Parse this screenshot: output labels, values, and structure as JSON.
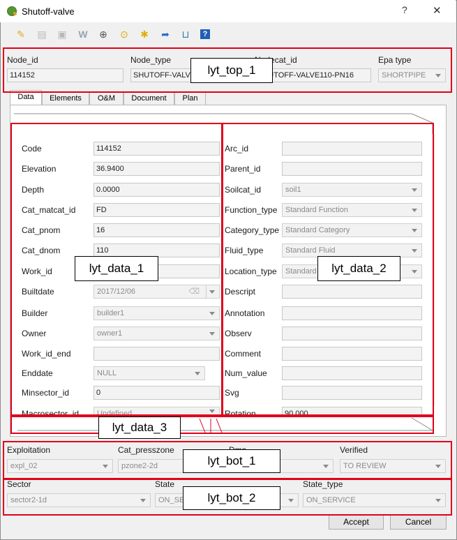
{
  "window": {
    "title": "Shutoff-valve",
    "help_glyph": "?",
    "close_glyph": "✕"
  },
  "toolbar": {
    "tools": [
      "edit-pencil-icon",
      "copy-icon",
      "paste-icon",
      "word-icon",
      "zoom-icon",
      "search-icon",
      "cluster-icon",
      "redo-icon",
      "bucket-icon",
      "help-icon"
    ]
  },
  "top": {
    "node_id_label": "Node_id",
    "node_id_value": "114152",
    "node_type_label": "Node_type",
    "node_type_value": "SHUTOFF-VALVE",
    "nodecat_id_label": "Nodecat_id",
    "nodecat_id_value": "SHUTOFF-VALVE110-PN16",
    "epa_type_label": "Epa type",
    "epa_type_value": "SHORTPIPE"
  },
  "tabs": [
    "Data",
    "Elements",
    "O&M",
    "Document",
    "Plan"
  ],
  "data_left": [
    {
      "label": "Code",
      "value": "114152",
      "kind": "field"
    },
    {
      "label": "Elevation",
      "value": "36.9400",
      "kind": "field"
    },
    {
      "label": "Depth",
      "value": "0.0000",
      "kind": "field"
    },
    {
      "label": "Cat_matcat_id",
      "value": "FD",
      "kind": "field"
    },
    {
      "label": "Cat_pnom",
      "value": "16",
      "kind": "field"
    },
    {
      "label": "Cat_dnom",
      "value": "110",
      "kind": "field"
    },
    {
      "label": "Work_id",
      "value": "",
      "kind": "field"
    },
    {
      "label": "Builtdate",
      "value": "2017/12/06",
      "kind": "date"
    },
    {
      "label": "Builder",
      "value": "builder1",
      "kind": "combo"
    },
    {
      "label": "Owner",
      "value": "owner1",
      "kind": "combo"
    },
    {
      "label": "Work_id_end",
      "value": "",
      "kind": "field"
    },
    {
      "label": "Enddate",
      "value": "NULL",
      "kind": "combo"
    },
    {
      "label": "Minsector_id",
      "value": "0",
      "kind": "field"
    },
    {
      "label": "Macrosector_id",
      "value": "Undefined",
      "kind": "combo"
    }
  ],
  "data_right": [
    {
      "label": "Arc_id",
      "value": "",
      "kind": "field"
    },
    {
      "label": "Parent_id",
      "value": "",
      "kind": "field"
    },
    {
      "label": "Soilcat_id",
      "value": "soil1",
      "kind": "combo"
    },
    {
      "label": "Function_type",
      "value": "Standard Function",
      "kind": "combo"
    },
    {
      "label": "Category_type",
      "value": "Standard Category",
      "kind": "combo"
    },
    {
      "label": "Fluid_type",
      "value": "Standard Fluid",
      "kind": "combo"
    },
    {
      "label": "Location_type",
      "value": "Standard Location",
      "kind": "combo"
    },
    {
      "label": "Descript",
      "value": "",
      "kind": "field"
    },
    {
      "label": "Annotation",
      "value": "",
      "kind": "field"
    },
    {
      "label": "Observ",
      "value": "",
      "kind": "field"
    },
    {
      "label": "Comment",
      "value": "",
      "kind": "field"
    },
    {
      "label": "Num_value",
      "value": "",
      "kind": "field"
    },
    {
      "label": "Svg",
      "value": "",
      "kind": "field"
    },
    {
      "label": "Rotation",
      "value": "90.000",
      "kind": "field"
    }
  ],
  "bot1": {
    "exploitation_label": "Exploitation",
    "exploitation_value": "expl_02",
    "presszone_label": "Cat_presszone",
    "presszone_value": "pzone2-2d",
    "dma_label": "Dma",
    "dma_value": "",
    "verified_label": "Verified",
    "verified_value": "TO REVIEW"
  },
  "bot2": {
    "sector_label": "Sector",
    "sector_value": "sector2-1d",
    "state_label": "State",
    "state_value": "ON_SERVICE",
    "state_type_label": "State_type",
    "state_type_value": "ON_SERVICE"
  },
  "buttons": {
    "accept": "Accept",
    "cancel": "Cancel"
  },
  "callouts": {
    "top1": "lyt_top_1",
    "data1": "lyt_data_1",
    "data2": "lyt_data_2",
    "data3": "lyt_data_3",
    "bot1": "lyt_bot_1",
    "bot2": "lyt_bot_2"
  },
  "colors": {
    "highlight": "#e0001a",
    "panel": "#ffffff",
    "chrome": "#f0f0f0"
  }
}
